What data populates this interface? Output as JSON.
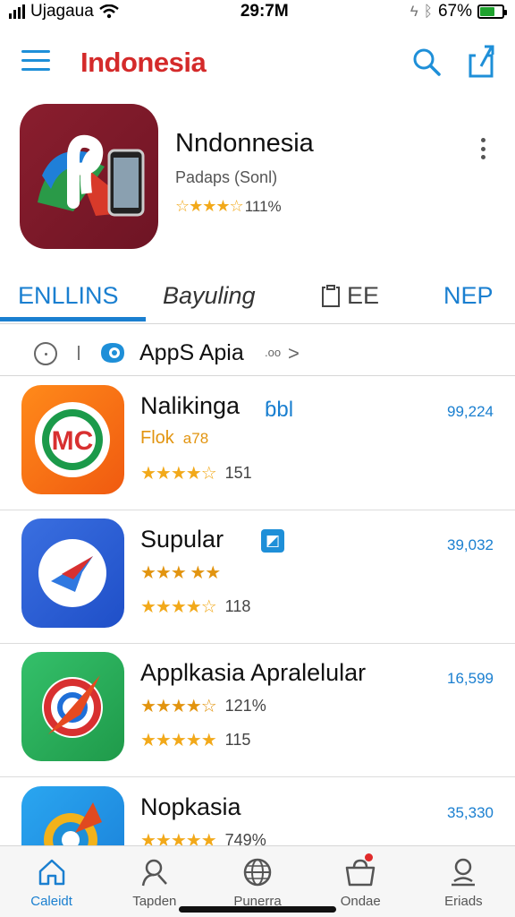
{
  "status_bar": {
    "carrier": "Ujagaua",
    "time": "29:7M",
    "battery": "67%",
    "battery_level": 0.67,
    "battery_color": "#1fa22e"
  },
  "nav": {
    "title": "Indonesia",
    "title_color": "#d42a2a",
    "accent": "#1a7fd0",
    "icons": [
      "menu-icon",
      "search-icon",
      "share-icon"
    ]
  },
  "hero": {
    "name": "Nndonnesia",
    "subtitle": "Padaps (Sonl)",
    "stars": "☆★★★☆",
    "rating_text": "111%"
  },
  "tabs": [
    {
      "label": "ENLLINS",
      "active": true
    },
    {
      "label": "Bayuling",
      "active": false
    },
    {
      "label": "EE",
      "active": false
    },
    {
      "label": "NEP",
      "active": false
    }
  ],
  "filter": {
    "label": "AppS Apia",
    "meta": ".oo"
  },
  "apps": [
    {
      "name": "Nalikinga",
      "badge": "ɓbl",
      "line2_text": "Flok",
      "line2_extra": "a78",
      "stars": "★★★★☆",
      "count": "151",
      "price": "99,224"
    },
    {
      "name": "Supular",
      "badge": "◩",
      "line2_stars": "★★★ ★★",
      "stars": "★★★★☆",
      "count": "118",
      "price": "39,032"
    },
    {
      "name": "Applkasia Apralelular",
      "line2_stars": "★★★★☆",
      "line2_text": "121%",
      "stars": "★★★★★",
      "count": "115",
      "price": "16,599"
    },
    {
      "name": "Nopkasia",
      "stars": "★★★★★",
      "count": "749%",
      "price": "35,330"
    }
  ],
  "bottom_tabs": [
    {
      "label": "Caleidt",
      "icon": "home-icon",
      "active": true
    },
    {
      "label": "Tapden",
      "icon": "search-person-icon",
      "active": false
    },
    {
      "label": "Punerra",
      "icon": "globe-icon",
      "active": false
    },
    {
      "label": "Ondae",
      "icon": "bag-icon",
      "active": false
    },
    {
      "label": "Eriads",
      "icon": "profile-icon",
      "active": false
    }
  ]
}
